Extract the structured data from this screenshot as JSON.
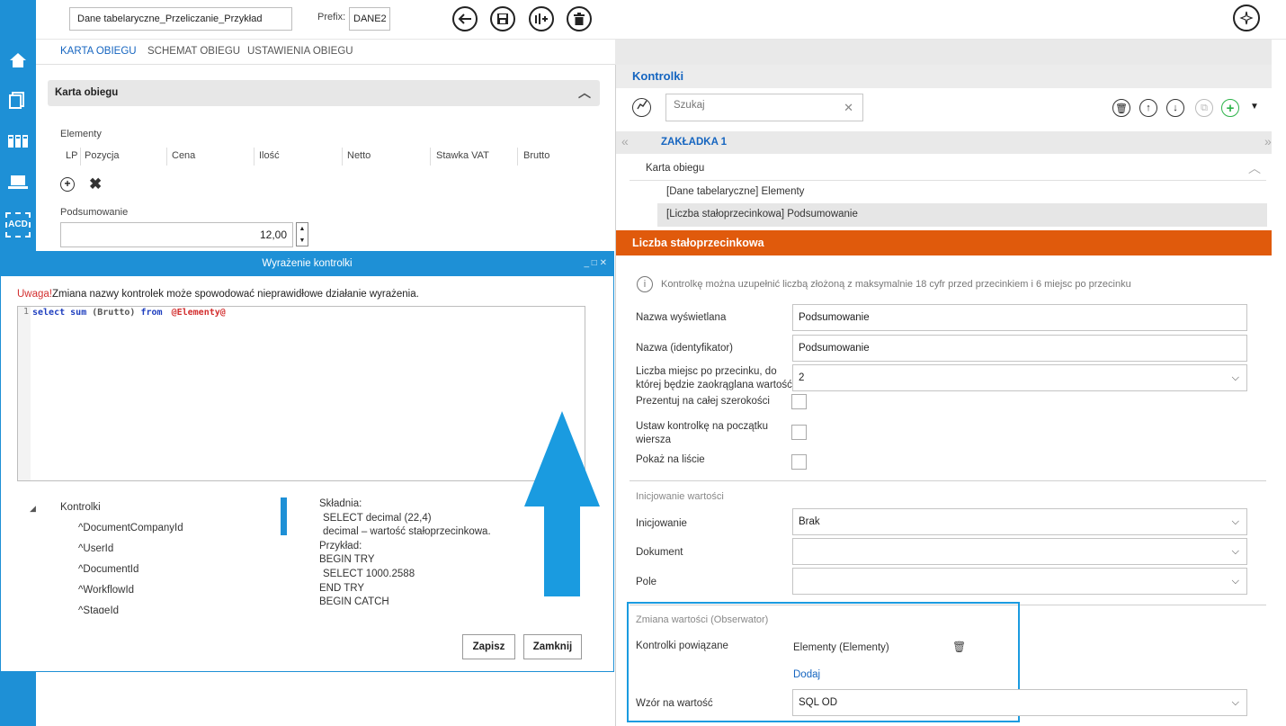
{
  "sidebar": {
    "icons": [
      "home-icon",
      "documents-icon",
      "kanban-icon",
      "laptop-icon",
      "acd-icon"
    ],
    "acd_label": "ACD"
  },
  "toolbar": {
    "name_value": "Dane tabelaryczne_Przeliczanie_Przykład",
    "prefix_label": "Prefix:",
    "prefix_value": "DANE2",
    "icons": [
      "back-icon",
      "save-icon",
      "versions-icon",
      "delete-icon",
      "magic-icon"
    ]
  },
  "tabs": [
    {
      "label": "KARTA OBIEGU",
      "active": true
    },
    {
      "label": "SCHEMAT OBIEGU",
      "active": false
    },
    {
      "label": "USTAWIENIA OBIEGU",
      "active": false
    }
  ],
  "card": {
    "header": "Karta obiegu",
    "elements_label": "Elementy",
    "columns": [
      "LP",
      "Pozycja",
      "Cena",
      "Ilość",
      "Netto",
      "Stawka VAT",
      "Brutto"
    ],
    "summary_label": "Podsumowanie",
    "summary_value": "12,00"
  },
  "dialog": {
    "title": "Wyrażenie kontrolki",
    "warning_prefix": "Uwaga!",
    "warning_text": "Zmiana nazwy kontrolek może spowodować nieprawidłowe działanie wyrażenia.",
    "code_line_no": "1",
    "code": {
      "select": "select",
      "sum": "sum",
      "paren": "(Brutto)",
      "from": "from",
      "var": "@Elementy@"
    },
    "tree_root": "Kontrolki",
    "tree_items": [
      "^DocumentCompanyId",
      "^UserId",
      "^DocumentId",
      "^WorkflowId",
      "^StageId"
    ],
    "syntax_lines": [
      "Składnia:",
      "  SELECT decimal (22,4)",
      "  decimal – wartość stałoprzecinkowa.",
      "Przykład:",
      "BEGIN TRY",
      "  SELECT 1000.2588",
      "END TRY",
      "BEGIN CATCH"
    ],
    "save_label": "Zapisz",
    "close_label": "Zamknij"
  },
  "right": {
    "header": "Kontrolki",
    "search_placeholder": "Szukaj",
    "tab_label": "ZAKŁADKA 1",
    "tree_root": "Karta obiegu",
    "tree_items": [
      "[Dane tabelaryczne] Elementy",
      "[Liczba stałoprzecinkowa] Podsumowanie"
    ],
    "section_title": "Liczba stałoprzecinkowa",
    "info_text": "Kontrolkę można uzupełnić liczbą złożoną z maksymalnie 18 cyfr przed przecinkiem i 6 miejsc po przecinku",
    "fields": {
      "display_name_label": "Nazwa wyświetlana",
      "display_name_value": "Podsumowanie",
      "identifier_label": "Nazwa (identyfikator)",
      "identifier_value": "Podsumowanie",
      "decimals_label_1": "Liczba miejsc po przecinku, do",
      "decimals_label_2": "której będzie zaokrąglana wartość",
      "decimals_value": "2",
      "full_width_label": "Prezentuj na całej szerokości",
      "row_start_label_1": "Ustaw kontrolkę na początku",
      "row_start_label_2": "wiersza",
      "show_list_label": "Pokaż na liście"
    },
    "init": {
      "section": "Inicjowanie wartości",
      "init_label": "Inicjowanie",
      "init_value": "Brak",
      "doc_label": "Dokument",
      "doc_value": "",
      "field_label": "Pole",
      "field_value": ""
    },
    "observer": {
      "section": "Zmiana wartości (Obserwator)",
      "linked_label": "Kontrolki powiązane",
      "linked_value": "Elementy (Elementy)",
      "add_label": "Dodaj",
      "formula_label": "Wzór na wartość",
      "formula_value": "SQL OD"
    }
  },
  "colors": {
    "accent": "#1e90d6",
    "orange": "#e05a0c",
    "warning": "#d32f2f",
    "arrow": "#1a9be0",
    "link": "#1565c0"
  }
}
